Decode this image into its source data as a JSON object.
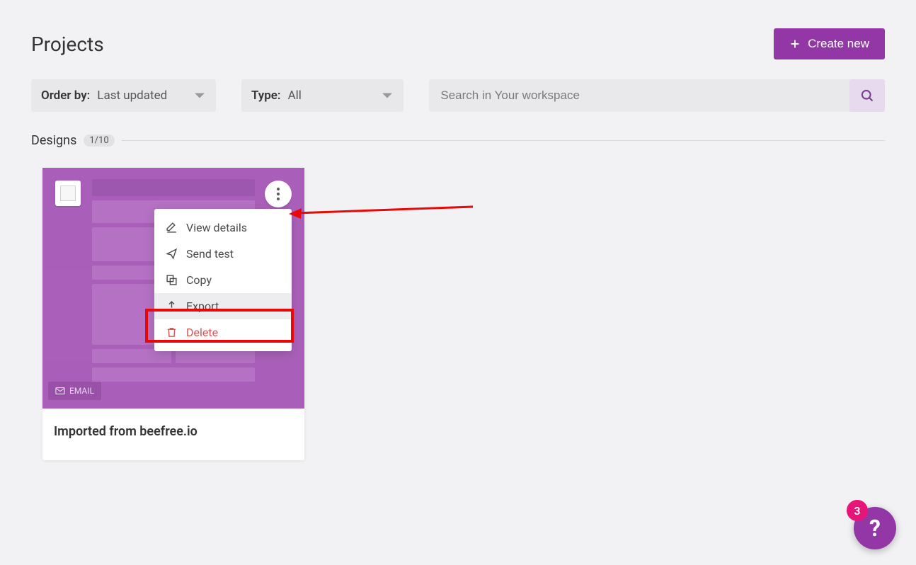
{
  "header": {
    "title": "Projects",
    "create_label": "Create new"
  },
  "filters": {
    "order_label": "Order by:",
    "order_value": "Last updated",
    "type_label": "Type:",
    "type_value": "All"
  },
  "search": {
    "placeholder": "Search in Your workspace"
  },
  "section": {
    "label": "Designs",
    "badge": "1/10"
  },
  "card": {
    "title": "Imported from beefree.io",
    "badge_label": "EMAIL"
  },
  "menu": {
    "view_details": "View details",
    "send_test": "Send test",
    "copy": "Copy",
    "export": "Export",
    "delete": "Delete"
  },
  "help": {
    "badge": "3",
    "label": "?"
  }
}
